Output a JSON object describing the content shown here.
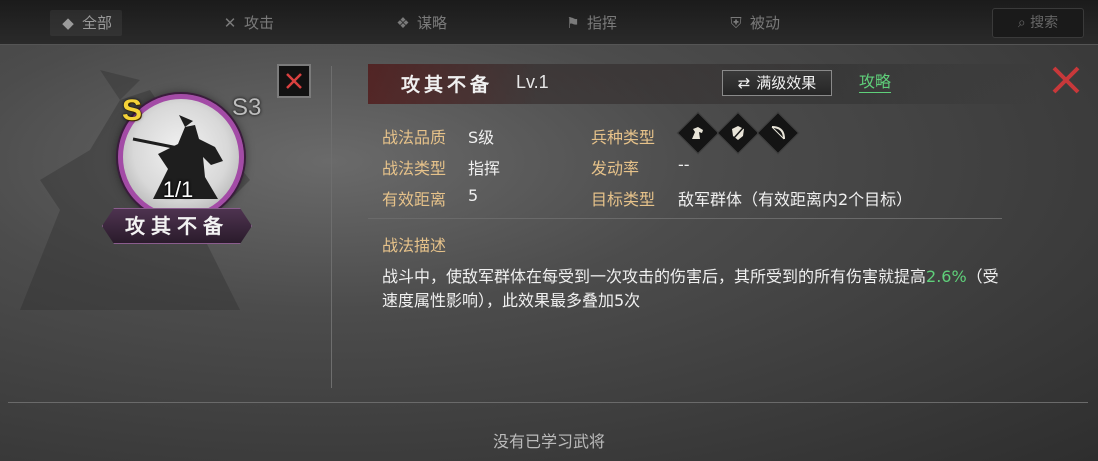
{
  "topbar": {
    "tabs": [
      {
        "label": "全部",
        "icon": "all-icon"
      },
      {
        "label": "攻击",
        "icon": "sword-icon"
      },
      {
        "label": "谋略",
        "icon": "strategy-icon"
      },
      {
        "label": "指挥",
        "icon": "command-icon"
      },
      {
        "label": "被动",
        "icon": "passive-icon"
      }
    ],
    "search_label": "搜索"
  },
  "skill_card": {
    "grade": "S",
    "level_badge": "S3",
    "count": "1/1",
    "name": "攻其不备",
    "ring_color": "#a34ba6"
  },
  "header": {
    "title": "攻其不备",
    "level": "Lv.1",
    "max_effect_label": "满级效果",
    "guide_label": "攻略"
  },
  "info": {
    "quality_label": "战法品质",
    "quality_value": "S级",
    "type_label": "战法类型",
    "type_value": "指挥",
    "range_label": "有效距离",
    "range_value": "5",
    "troop_label": "兵种类型",
    "troop_icons": [
      "cavalry-icon",
      "shield-icon",
      "bow-icon"
    ],
    "rate_label": "发动率",
    "rate_value": "--",
    "target_label": "目标类型",
    "target_value": "敌军群体（有效距离内2个目标）"
  },
  "description": {
    "title": "战法描述",
    "text_part1": "战斗中，使敌军群体在每受到一次攻击的伤害后，其所受到的所有伤害就提高",
    "highlight": "2.6%",
    "text_part2": "（受速度属性影响），此效果最多叠加5次"
  },
  "footer": {
    "message": "没有已学习武将"
  },
  "colors": {
    "label_gold": "#e6c28a",
    "highlight_green": "#5fd07a",
    "close_red": "#c8383a"
  }
}
